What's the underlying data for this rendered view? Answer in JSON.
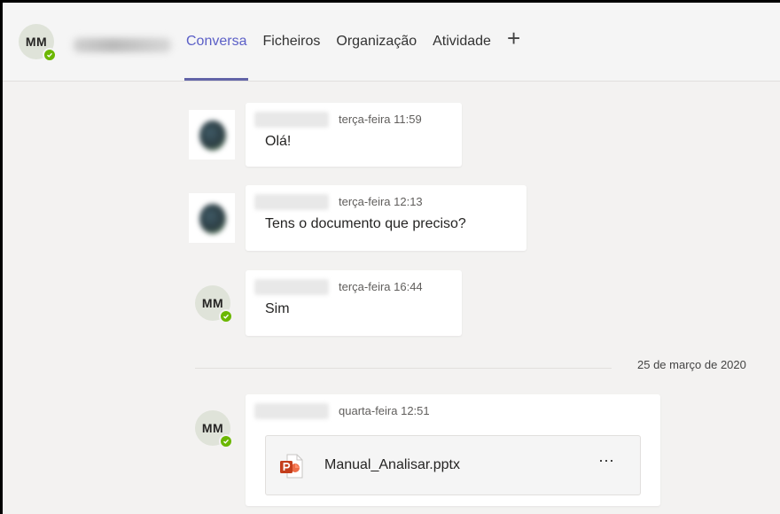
{
  "header": {
    "avatar_initials": "MM",
    "tabs": [
      {
        "label": "Conversa"
      },
      {
        "label": "Ficheiros"
      },
      {
        "label": "Organização"
      },
      {
        "label": "Atividade"
      }
    ],
    "add_tab_glyph": "+"
  },
  "messages": [
    {
      "time": "terça-feira 11:59",
      "text": "Olá!",
      "avatar": "photo"
    },
    {
      "time": "terça-feira 12:13",
      "text": "Tens o documento que preciso?",
      "avatar": "photo"
    },
    {
      "time": "terça-feira 16:44",
      "text": "Sim",
      "avatar_initials": "MM"
    },
    {
      "time": "quarta-feira 12:51",
      "avatar_initials": "MM",
      "attachment": {
        "file_name": "Manual_Analisar.pptx",
        "icon": "powerpoint-file-icon",
        "more_glyph": "···"
      }
    }
  ],
  "date_divider": "25 de março de 2020",
  "colors": {
    "accent": "#6264a7",
    "presence_available": "#6bb700",
    "powerpoint": "#c43e1c"
  }
}
